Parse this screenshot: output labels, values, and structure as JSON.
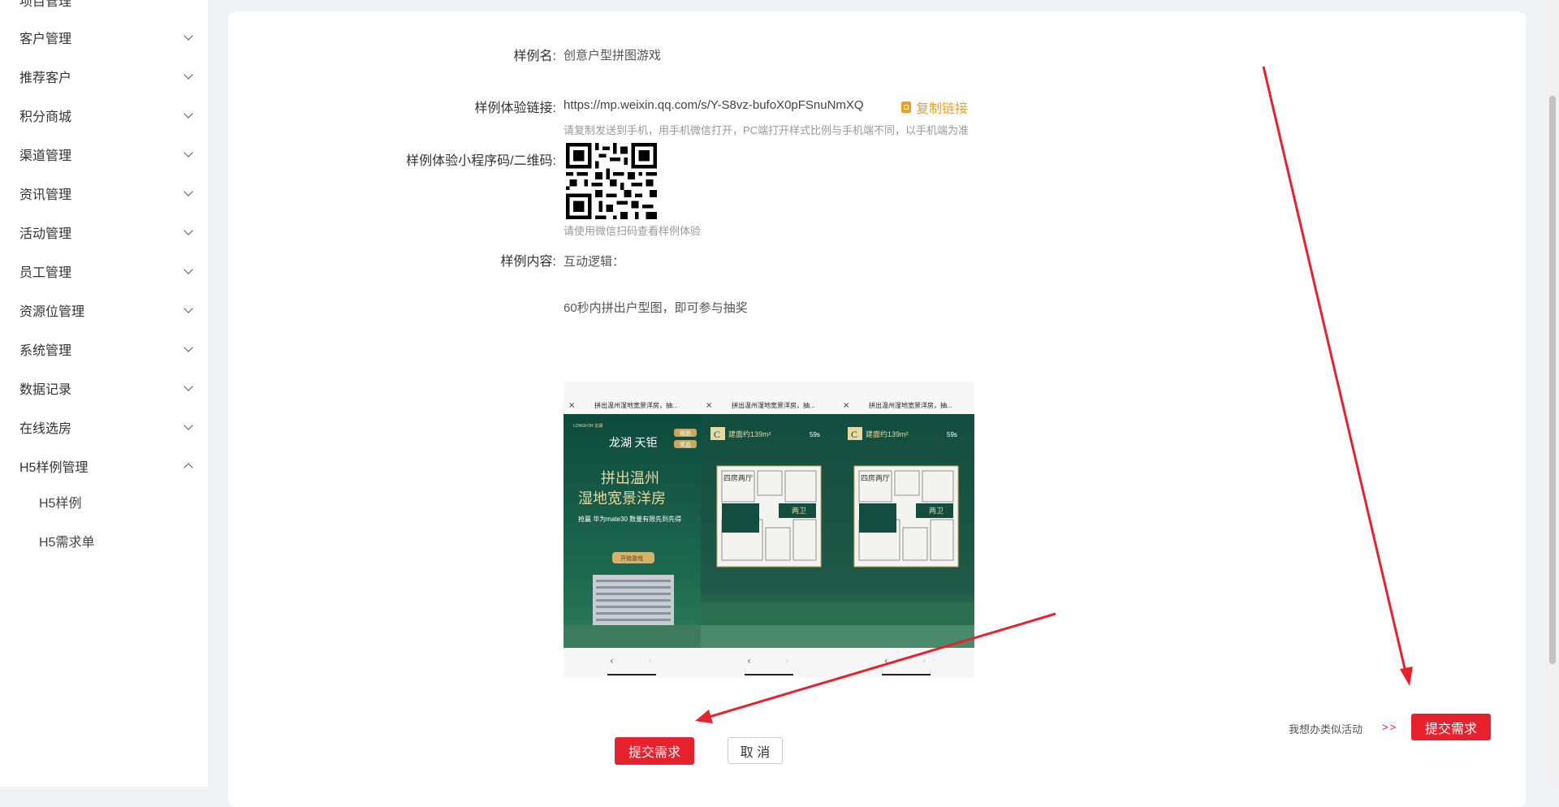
{
  "sidebar": {
    "top_partial": "项目管理",
    "items": [
      {
        "label": "客户管理"
      },
      {
        "label": "推荐客户"
      },
      {
        "label": "积分商城"
      },
      {
        "label": "渠道管理"
      },
      {
        "label": "资讯管理"
      },
      {
        "label": "活动管理"
      },
      {
        "label": "员工管理"
      },
      {
        "label": "资源位管理"
      },
      {
        "label": "系统管理"
      },
      {
        "label": "数据记录"
      },
      {
        "label": "在线选房"
      },
      {
        "label": "H5样例管理"
      }
    ],
    "subitems": [
      {
        "label": "H5样例"
      },
      {
        "label": "H5需求单"
      }
    ]
  },
  "form": {
    "name_label": "样例名:",
    "name_value": "创意户型拼图游戏",
    "link_label": "样例体验链接:",
    "link_value": "https://mp.weixin.qq.com/s/Y-S8vz-bufoX0pFSnuNmXQ",
    "copy_label": "复制链接",
    "link_hint": "请复制发送到手机，用手机微信打开，PC端打开样式比例与手机端不同，以手机端为准",
    "qr_label": "样例体验小程序码/二维码:",
    "qr_hint": "请使用微信扫码查看样例体验",
    "content_label": "样例内容:",
    "content_line1": "互动逻辑：",
    "content_line2": "60秒内拼出户型图，即可参与抽奖"
  },
  "phones": {
    "topbar_title_1": "拼出温州湿地宽景洋房，抽...",
    "topbar_title_2": "拼出温州湿地宽景洋房，抽...",
    "topbar_title_3": "拼出温州湿地宽景洋房，抽...",
    "brand": "LONGFOR 龙湖",
    "logo_text": "龙湖 天钜",
    "rule_btn": "规则",
    "prize_btn": "奖品",
    "headline1": "拼出温州",
    "headline2": "湿地宽景洋房",
    "prize_line": "抢赢 华为mate30 数量有限先到先得",
    "start_btn": "开始游戏",
    "unit_badge": "C",
    "area": "建面约139m²",
    "timer": "59s",
    "room_label": "四房两厅",
    "toilet_label": "两卫"
  },
  "actions": {
    "submit_label": "提交需求",
    "cancel_label": "取 消",
    "similar_text": "我想办类似活动",
    "similar_arrows": ">>",
    "submit_right_label": "提交需求"
  }
}
